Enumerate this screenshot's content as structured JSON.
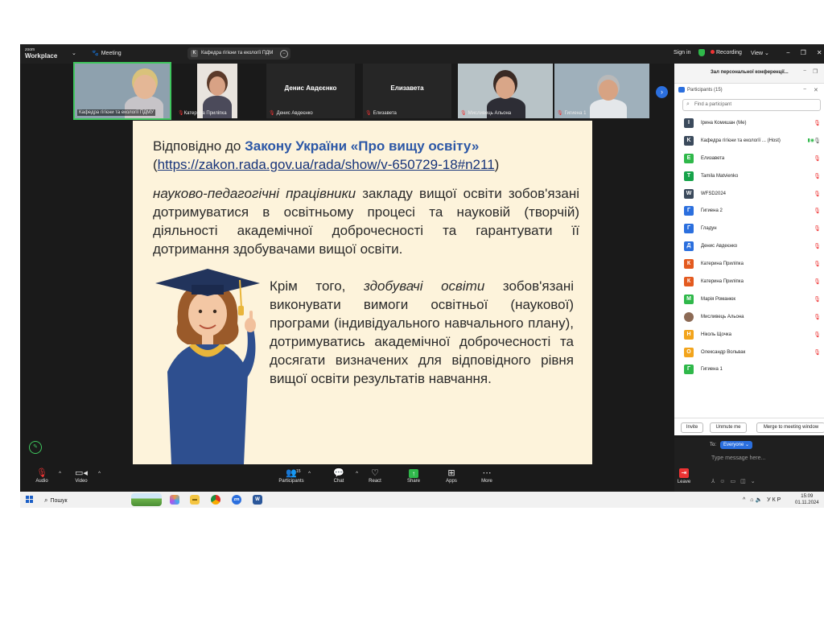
{
  "titlebar": {
    "brand_top": "zoom",
    "brand_bottom": "Workplace",
    "meeting_label": "Meeting",
    "tab_initial": "K",
    "tab_title": "Кафедра гігієни та екології ПДМ",
    "sign_in": "Sign in",
    "recording": "Recording",
    "view": "View"
  },
  "thumbnails": [
    {
      "name": "Кафедра гігієни та екології ПДМУ",
      "muted": false
    },
    {
      "name": "Катерина Приліпка",
      "muted": true
    },
    {
      "name": "Денис Авдеєнко",
      "center_name": "Денис Авдєєнко",
      "muted": true
    },
    {
      "name": "Елизавета",
      "center_name": "Елизавета",
      "muted": true
    },
    {
      "name": "Мисливець Альона",
      "muted": true
    },
    {
      "name": "Гигиена 1",
      "muted": true
    }
  ],
  "slide": {
    "line1_prefix": "Відповідно до ",
    "line1_law": "Закону України «Про вищу освіту»",
    "url_open": "(",
    "url": "https://zakon.rada.gov.ua/rada/show/v-650729-18#n211",
    "url_close": ")",
    "p1_italic": "науково-педагогічні працівники",
    "p1_rest": " закладу вищої освіти зобов'язані дотримуватися в освітньому процесі та науковій (творчій) діяльності академічної доброчесності та гарантувати її дотримання здобувачами вищої освіти.",
    "p2_prefix": "Крім того, ",
    "p2_italic": "здобувачі освіти",
    "p2_rest": " зобов'язані виконувати вимоги освітньої (наукової) програми (індивідуального навчального плану), дотримуватись академічної доброчесності та досягати визначених для відповідного рівня вищої освіти результатів навчання."
  },
  "panel": {
    "title": "Зал персональної конференції...",
    "participants_label": "Participants (15)",
    "search_placeholder": "Find a participant",
    "participants": [
      {
        "initial": "I",
        "name": "Ірина Комишан (Me)",
        "color": "#3b4a5c"
      },
      {
        "initial": "K",
        "name": "Кафедра гігієни та екології ... (Host)",
        "color": "#3b4a5c"
      },
      {
        "initial": "E",
        "name": "Елизавета",
        "color": "#2fb84a"
      },
      {
        "initial": "T",
        "name": "Tamila Matvienko",
        "color": "#16a34a"
      },
      {
        "initial": "W",
        "name": "WFSD2024",
        "color": "#3b4a5c"
      },
      {
        "initial": "Г",
        "name": "Гигиена 2",
        "color": "#2b6fde"
      },
      {
        "initial": "Г",
        "name": "Гладун",
        "color": "#2b6fde"
      },
      {
        "initial": "Д",
        "name": "Денис Авдеєнко",
        "color": "#2b6fde"
      },
      {
        "initial": "К",
        "name": "Катерина Приліпка",
        "color": "#e35a1f"
      },
      {
        "initial": "К",
        "name": "Катерина Приліпка",
        "color": "#e35a1f"
      },
      {
        "initial": "М",
        "name": "Марія Романюк",
        "color": "#2fb84a"
      },
      {
        "initial": "",
        "name": "Мисливець Альона",
        "color": "#8c6a55"
      },
      {
        "initial": "Н",
        "name": "Ніколь Щочка",
        "color": "#f2a41c"
      },
      {
        "initial": "О",
        "name": "Олександр Вольвак",
        "color": "#f2a41c"
      },
      {
        "initial": "Г",
        "name": "Гигиена 1",
        "color": "#2fb84a"
      }
    ],
    "invite": "Invite",
    "unmute_me": "Unmute me",
    "merge": "Merge to meeting window"
  },
  "chat": {
    "to": "To:",
    "everyone": "Everyone",
    "placeholder": "Type message here..."
  },
  "toolbar": {
    "audio": "Audio",
    "video": "Video",
    "participants": "Participants",
    "participants_count": "15",
    "chat": "Chat",
    "react": "React",
    "share": "Share",
    "apps": "Apps",
    "more": "More",
    "leave": "Leave"
  },
  "taskbar": {
    "search": "Пошук",
    "lang": "УКР",
    "time": "15:09",
    "date": "01.11.2024"
  }
}
